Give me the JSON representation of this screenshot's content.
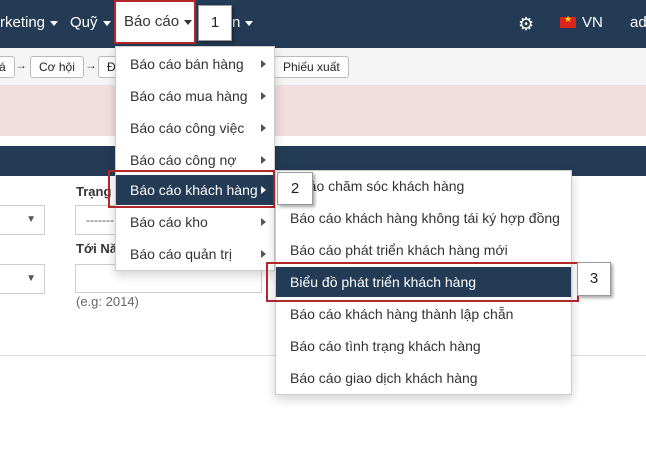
{
  "topnav": {
    "items": [
      {
        "label": "rketing"
      },
      {
        "label": "Quỹ"
      },
      {
        "label": "Báo cáo"
      },
      {
        "label": "n"
      }
    ],
    "language": "VN",
    "user": "ad"
  },
  "callouts": [
    "1",
    "2",
    "3"
  ],
  "pipeline": {
    "items": [
      "á",
      "Cơ hội",
      "Đ",
      "Phiếu xuất"
    ]
  },
  "form": {
    "status_label": "Trạng t",
    "status_placeholder": "-------",
    "to_year_label": "Tới Nă",
    "year_hint": "(e.g: 2014)"
  },
  "report_menu": {
    "items": [
      "Báo cáo bán hàng",
      "Báo cáo mua hàng",
      "Báo cáo công việc",
      "Báo cáo công nợ",
      "Báo cáo khách hàng",
      "Báo cáo kho",
      "Báo cáo quản trị"
    ]
  },
  "customer_submenu": {
    "items": [
      "o cáo chăm sóc khách hàng",
      "Báo cáo khách hàng không tái ký hợp đồng",
      "Báo cáo phát triển khách hàng mới",
      "Biểu đồ phát triển khách hàng",
      "Báo cáo khách hàng thành lập chẵn",
      "Báo cáo tình trạng khách hàng",
      "Báo cáo giao dịch khách hàng"
    ]
  }
}
